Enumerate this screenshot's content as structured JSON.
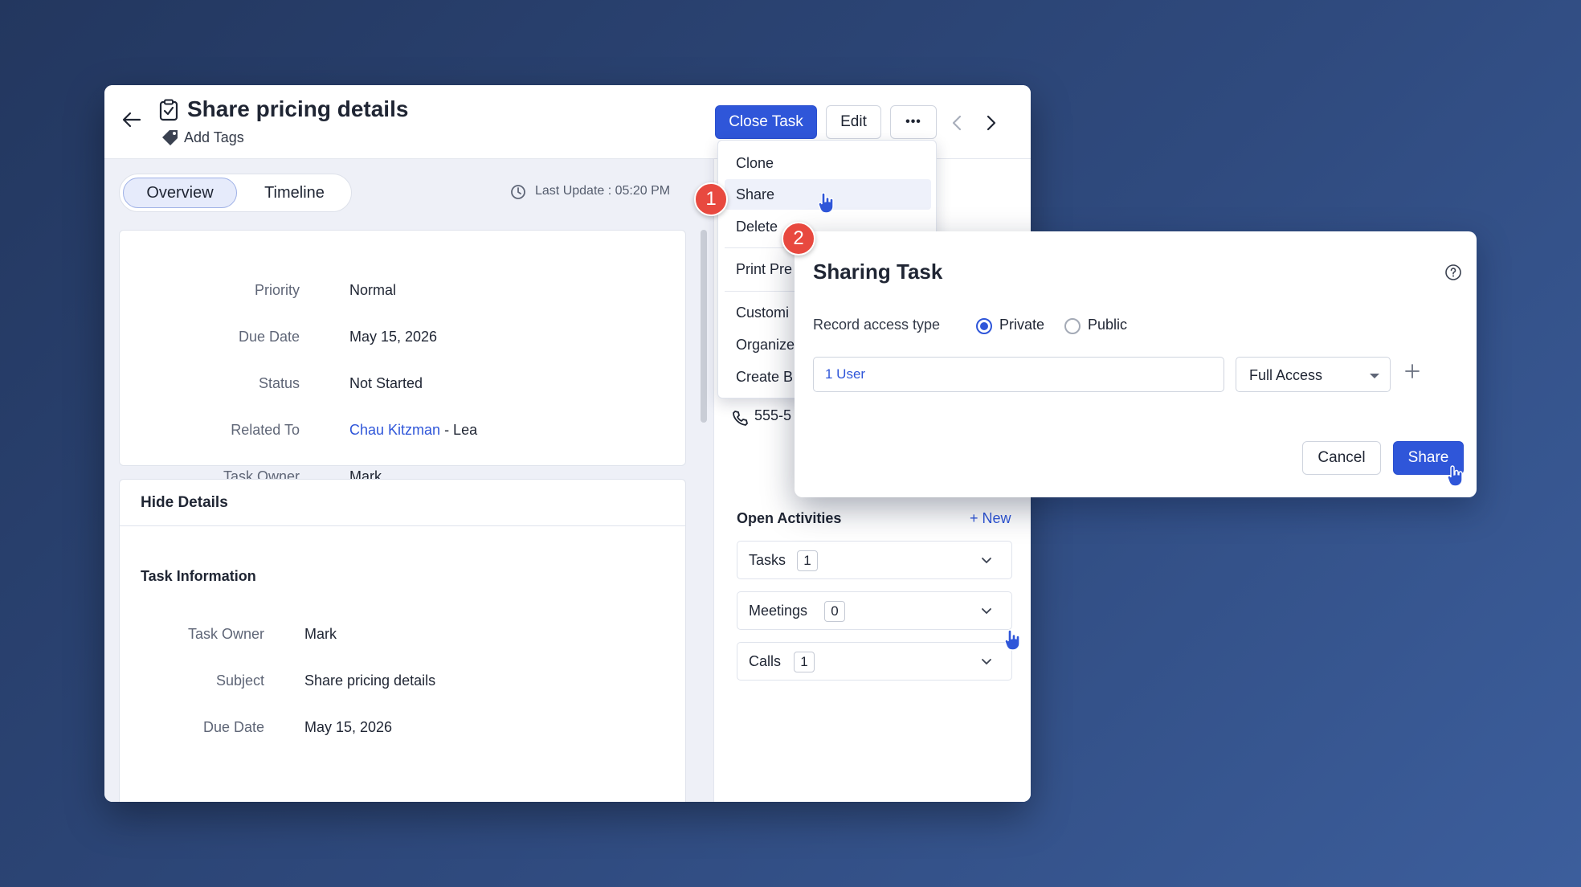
{
  "task": {
    "title": "Share pricing details",
    "add_tags_label": "Add Tags"
  },
  "toolbar": {
    "close_task_label": "Close Task",
    "edit_label": "Edit",
    "more_label": "•••"
  },
  "tabs": {
    "overview_label": "Overview",
    "timeline_label": "Timeline"
  },
  "last_update": "Last Update : 05:20 PM",
  "summary_fields": [
    {
      "label": "Priority",
      "value": "Normal"
    },
    {
      "label": "Due Date",
      "value": "May 15, 2026"
    },
    {
      "label": "Status",
      "value": "Not Started"
    },
    {
      "label": "Related To",
      "value": "Chau Kitzman",
      "suffix": " - Lea"
    },
    {
      "label": "Task Owner",
      "value": "Mark"
    }
  ],
  "details": {
    "hide_details_label": "Hide Details",
    "section_title": "Task Information",
    "fields": [
      {
        "label": "Task Owner",
        "value": "Mark"
      },
      {
        "label": "Subject",
        "value": "Share pricing details"
      },
      {
        "label": "Due Date",
        "value": "May 15, 2026"
      }
    ]
  },
  "right_panel": {
    "phone_partial": "555-5",
    "open_activities_label": "Open Activities",
    "new_link": "+ New",
    "activities": [
      {
        "label": "Tasks",
        "count": "1"
      },
      {
        "label": "Meetings",
        "count": "0"
      },
      {
        "label": "Calls",
        "count": "1"
      }
    ]
  },
  "more_menu": {
    "items": [
      "Clone",
      "Share",
      "Delete",
      "Print Pre",
      "Customi",
      "Organize",
      "Create B"
    ]
  },
  "steps": [
    "1",
    "2"
  ],
  "dialog": {
    "title": "Sharing Task",
    "record_access_label": "Record access type",
    "radio_private": "Private",
    "radio_public": "Public",
    "selected_access_type": "Private",
    "users_value": "1 User",
    "access_level": "Full Access",
    "cancel_label": "Cancel",
    "share_label": "Share"
  },
  "colors": {
    "accent": "#2f56d9",
    "step_badge": "#e8493f"
  }
}
